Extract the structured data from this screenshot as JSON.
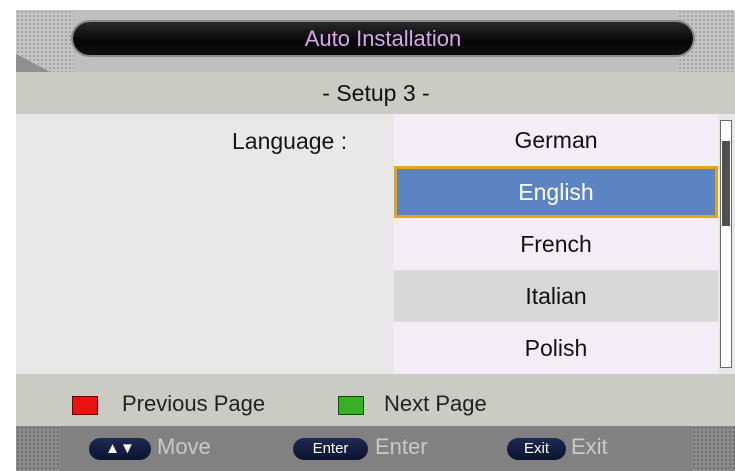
{
  "header": {
    "title": "Auto Installation"
  },
  "subtitle": "- Setup 3 -",
  "language": {
    "label": "Language :",
    "options": [
      "German",
      "English",
      "French",
      "Italian",
      "Polish"
    ],
    "selected": "English",
    "scroll_thumb_fraction": 0.35
  },
  "legend": {
    "previous_label": "Previous Page",
    "next_label": "Next Page",
    "red_color": "#ee1111",
    "green_color": "#37b026"
  },
  "keys": {
    "move_key": "▲▼",
    "move_label": "Move",
    "enter_key": "Enter",
    "enter_label": "Enter",
    "exit_key": "Exit",
    "exit_label": "Exit"
  },
  "colors": {
    "title_text": "#d9a6ee",
    "selected_bg": "#5c84c2",
    "selected_border": "#e3a415"
  }
}
